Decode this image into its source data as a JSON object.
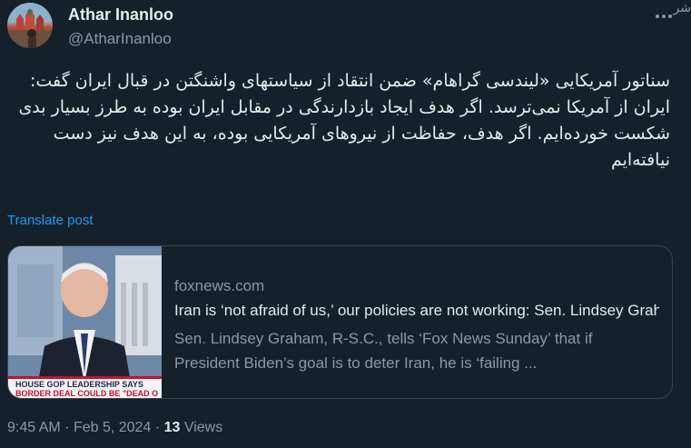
{
  "author": {
    "name": "Athar Inanloo",
    "handle": "@AtharInanloo"
  },
  "watermark": "شر",
  "tweet": {
    "lines": [
      "سناتور آمریکایی «لیندسی گراهام» ضمن انتقاد از سیاستهای واشنگتن در قبال ایران گفت:",
      "ایران از آمریکا نمی‌ترسد. اگر هدف ایجاد بازدارندگی در مقابل ایران بوده به طرز بسیار بدی شکست خورده‌ایم. اگر هدف، حفاظت از نیروهای آمریکایی بوده، به این هدف نیز دست نیافته‌ایم"
    ],
    "translate_label": "Translate post"
  },
  "card": {
    "domain": "foxnews.com",
    "title": "Iran is ‘not afraid of us,’ our policies are not working: Sen. Lindsey Graham",
    "description_line1": "Sen. Lindsey Graham, R-S.C., tells ‘Fox News Sunday’ that if",
    "description_line2": "President Biden’s goal is to deter Iran, he is ‘failing ...",
    "thumb_banner_line1": "HOUSE GOP LEADERSHIP SAYS",
    "thumb_banner_line2": "BORDER DEAL COULD BE \"DEAD O"
  },
  "meta": {
    "time": "9:45 AM",
    "separator": "·",
    "date": "Feb 5, 2024",
    "views_count": "13",
    "views_label": "Views"
  },
  "colors": {
    "background": "#15202b",
    "text": "#e7e9ea",
    "secondary": "#8b98a5",
    "link": "#1d9bf0",
    "border": "#38444d"
  },
  "icons": {
    "more": "more-dots-icon"
  }
}
